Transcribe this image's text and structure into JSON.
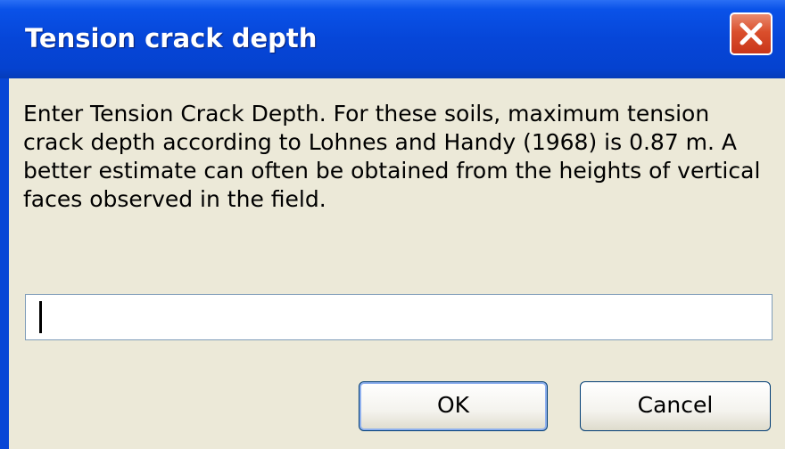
{
  "dialog": {
    "title": "Tension crack depth",
    "message": "Enter Tension Crack Depth. For these soils, maximum tension crack depth according to Lohnes and Handy (1968) is 0.87 m.  A better estimate can often be obtained from the heights of vertical faces observed in the field.",
    "input": {
      "value": "",
      "placeholder": ""
    },
    "buttons": {
      "ok_label": "OK",
      "cancel_label": "Cancel"
    },
    "close_icon": "close-icon"
  },
  "colors": {
    "titlebar": "#0646d8",
    "client_background": "#ece9d8",
    "close_button": "#da4f2c",
    "title_text": "#ffffff"
  }
}
